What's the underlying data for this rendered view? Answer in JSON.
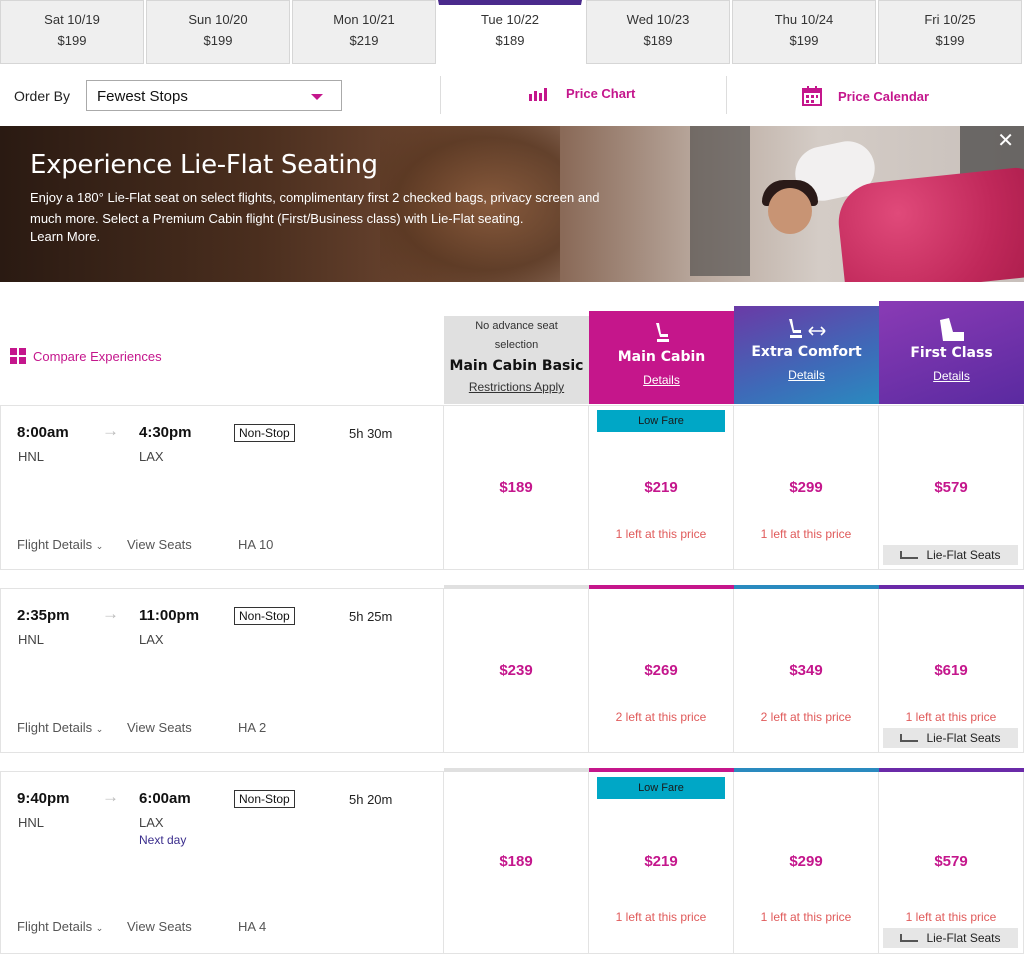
{
  "date_tabs": [
    {
      "date": "Sat 10/19",
      "price": "$199"
    },
    {
      "date": "Sun 10/20",
      "price": "$199"
    },
    {
      "date": "Mon 10/21",
      "price": "$219"
    },
    {
      "date": "Tue 10/22",
      "price": "$189"
    },
    {
      "date": "Wed 10/23",
      "price": "$189"
    },
    {
      "date": "Thu 10/24",
      "price": "$199"
    },
    {
      "date": "Fri 10/25",
      "price": "$199"
    }
  ],
  "active_tab": 3,
  "order": {
    "label": "Order By",
    "value": "Fewest Stops"
  },
  "tools": {
    "price_chart": "Price Chart",
    "price_calendar": "Price Calendar"
  },
  "banner": {
    "title": "Experience Lie-Flat Seating",
    "text": "Enjoy a 180° Lie-Flat seat on select flights, complimentary first 2 checked bags, privacy screen and much more. Select a Premium Cabin flight (First/Business class) with Lie-Flat seating.",
    "learn_more": "Learn More.",
    "close": "✕"
  },
  "compare_label": "Compare Experiences",
  "cabins": {
    "basic": {
      "sub": "No advance seat selection",
      "name": "Main Cabin Basic",
      "link": "Restrictions Apply"
    },
    "main": {
      "name": "Main Cabin",
      "link": "Details"
    },
    "extra": {
      "name": "Extra Comfort",
      "link": "Details"
    },
    "first": {
      "name": "First Class",
      "link": "Details"
    }
  },
  "labels": {
    "flight_details": "Flight Details",
    "view_seats": "View Seats",
    "low_fare": "Low Fare",
    "lie_flat": "Lie-Flat Seats"
  },
  "flights": [
    {
      "depart": "8:00am",
      "arrive": "4:30pm",
      "from": "HNL",
      "to": "LAX",
      "next_day": "",
      "stops": "Non-Stop",
      "duration": "5h 30m",
      "flight_no": "HA 10",
      "prices": [
        "$189",
        "$219",
        "$299",
        "$579"
      ],
      "availability": [
        "",
        "1 left at this price",
        "1 left at this price",
        ""
      ]
    },
    {
      "depart": "2:35pm",
      "arrive": "11:00pm",
      "from": "HNL",
      "to": "LAX",
      "next_day": "",
      "stops": "Non-Stop",
      "duration": "5h 25m",
      "flight_no": "HA 2",
      "prices": [
        "$239",
        "$269",
        "$349",
        "$619"
      ],
      "availability": [
        "",
        "2 left at this price",
        "2 left at this price",
        "1 left at this price"
      ]
    },
    {
      "depart": "9:40pm",
      "arrive": "6:00am",
      "from": "HNL",
      "to": "LAX",
      "next_day": "Next day",
      "stops": "Non-Stop",
      "duration": "5h 20m",
      "flight_no": "HA 4",
      "prices": [
        "$189",
        "$219",
        "$299",
        "$579"
      ],
      "availability": [
        "",
        "1 left at this price",
        "1 left at this price",
        "1 left at this price"
      ]
    }
  ],
  "colors": {
    "accent": "#c4168c",
    "main_cabin": "#c5168b",
    "extra_comfort": "#2a8abf",
    "first_class": "#6a2aa8",
    "low_fare": "#00a7c6"
  }
}
